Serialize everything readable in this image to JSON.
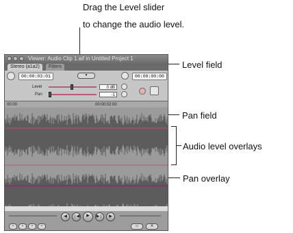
{
  "callouts": {
    "drag_line1": "Drag the Level slider",
    "drag_line2": "to change the audio level.",
    "level_field": "Level field",
    "pan_field": "Pan field",
    "audio_level_overlays": "Audio level overlays",
    "pan_overlay": "Pan overlay"
  },
  "viewer": {
    "window_title": "Viewer: Audio Clip 1.aif in Untitled Project 1",
    "tabs": [
      "Stereo (a1a2)",
      "Filters"
    ],
    "duration_timecode": "00:00:03:01",
    "current_timecode": "00:00:00:00",
    "level_label": "Level",
    "level_value": "0 dB",
    "pan_label": "Pan",
    "pan_value": "-1",
    "ruler_start": "00:00",
    "ruler_mid": "00:00:02:00"
  },
  "colors": {
    "waveform": "#5c5c5c",
    "level_overlay": "#8c2f6a",
    "pan_overlay": "#b4527f",
    "panel_bg": "#c6c6c6"
  }
}
